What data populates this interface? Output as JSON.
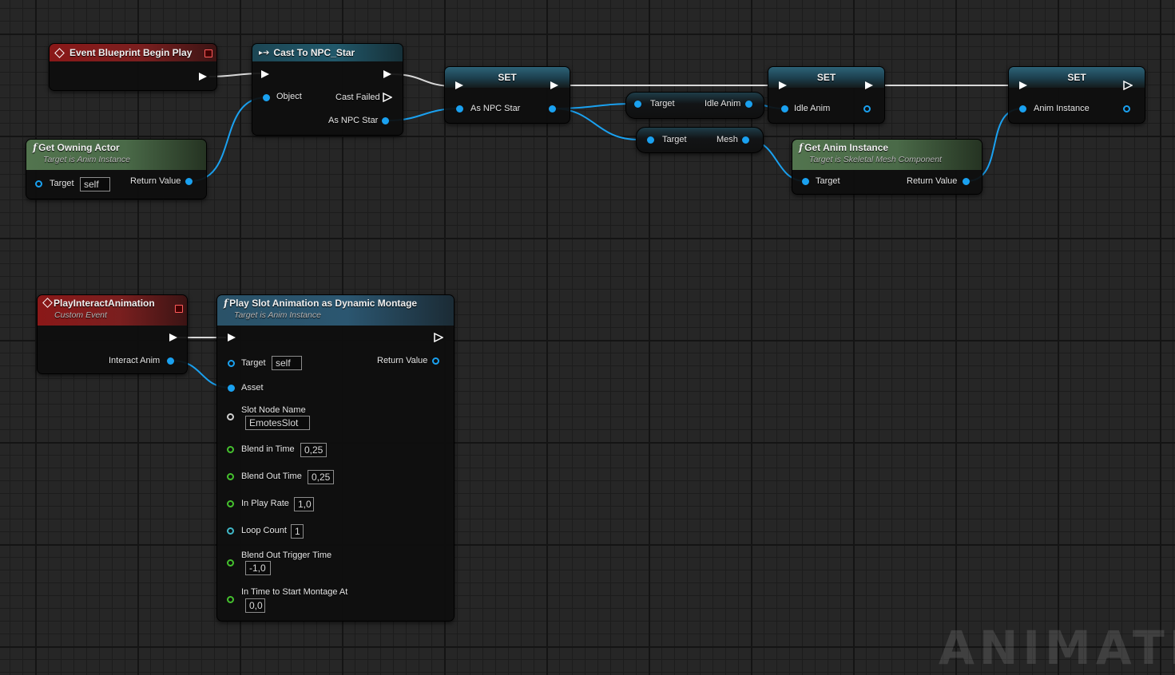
{
  "nodes": {
    "begin_play": {
      "title": "Event Blueprint Begin Play"
    },
    "cast": {
      "title": "Cast To NPC_Star",
      "object_label": "Object",
      "cast_failed_label": "Cast Failed",
      "as_label": "As NPC Star"
    },
    "get_owning_actor": {
      "title": "Get Owning Actor",
      "subtitle": "Target is Anim Instance",
      "target_label": "Target",
      "target_value": "self",
      "return_label": "Return Value"
    },
    "set1": {
      "title": "SET",
      "pin_label": "As NPC Star"
    },
    "get_idle": {
      "target_label": "Target",
      "out_label": "Idle Anim"
    },
    "get_mesh": {
      "target_label": "Target",
      "out_label": "Mesh"
    },
    "set2": {
      "title": "SET",
      "pin_label": "Idle Anim"
    },
    "get_anim_instance": {
      "title": "Get Anim Instance",
      "subtitle": "Target is Skeletal Mesh Component",
      "target_label": "Target",
      "return_label": "Return Value"
    },
    "set3": {
      "title": "SET",
      "pin_label": "Anim Instance"
    },
    "custom_event": {
      "title": "PlayInteractAnimation",
      "subtitle": "Custom Event",
      "out_label": "Interact Anim"
    },
    "play_slot": {
      "title": "Play Slot Animation as Dynamic Montage",
      "subtitle": "Target is Anim Instance",
      "target_label": "Target",
      "target_value": "self",
      "return_label": "Return Value",
      "asset_label": "Asset",
      "slot_label": "Slot Node Name",
      "slot_value": "EmotesSlot",
      "blend_in_label": "Blend in Time",
      "blend_in_value": "0,25",
      "blend_out_label": "Blend Out Time",
      "blend_out_value": "0,25",
      "play_rate_label": "In Play Rate",
      "play_rate_value": "1,0",
      "loop_label": "Loop Count",
      "loop_value": "1",
      "trigger_label": "Blend Out Trigger Time",
      "trigger_value": "-1,0",
      "start_label": "In Time to Start Montage At",
      "start_value": "0,0"
    }
  },
  "colors": {
    "exec": "#ffffff",
    "object_pin": "#1aa1f0",
    "float_pin": "#45c12e",
    "int_pin": "#40b8c8",
    "name_pin": "#cfcfcf"
  },
  "watermark": "ANIMATIC"
}
